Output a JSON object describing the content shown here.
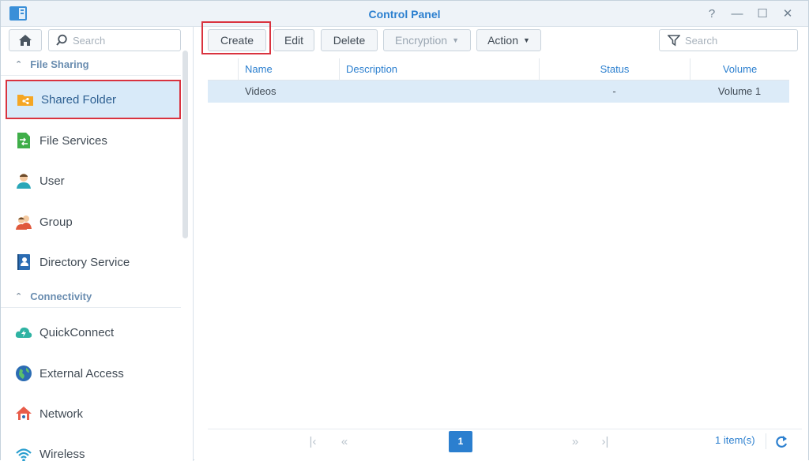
{
  "window": {
    "title": "Control Panel",
    "controls": {
      "help": "?",
      "minimize": "—",
      "maximize": "☐",
      "close": "✕"
    }
  },
  "sidebar": {
    "search_placeholder": "Search",
    "sections": [
      {
        "label": "File Sharing",
        "expanded": true
      },
      {
        "label": "Connectivity",
        "expanded": true
      }
    ],
    "items": [
      {
        "label": "Shared Folder",
        "icon": "shared-folder-icon",
        "selected": true
      },
      {
        "label": "File Services",
        "icon": "file-services-icon"
      },
      {
        "label": "User",
        "icon": "user-icon"
      },
      {
        "label": "Group",
        "icon": "group-icon"
      },
      {
        "label": "Directory Service",
        "icon": "directory-service-icon"
      },
      {
        "label": "QuickConnect",
        "icon": "quickconnect-icon"
      },
      {
        "label": "External Access",
        "icon": "external-access-icon"
      },
      {
        "label": "Network",
        "icon": "network-icon"
      },
      {
        "label": "Wireless",
        "icon": "wireless-icon"
      }
    ]
  },
  "toolbar": {
    "create": "Create",
    "edit": "Edit",
    "delete": "Delete",
    "encryption": "Encryption",
    "action": "Action",
    "search_placeholder": "Search"
  },
  "grid": {
    "columns": [
      "Name",
      "Description",
      "Status",
      "Volume"
    ],
    "rows": [
      {
        "name": "Videos",
        "description": "",
        "status": "-",
        "volume": "Volume 1",
        "selected": true
      }
    ]
  },
  "pager": {
    "current_page": "1",
    "item_count": "1 item(s)"
  },
  "colors": {
    "accent": "#2b7fcf",
    "highlight": "#d9333f",
    "selected_bg": "#d8eaf9"
  }
}
